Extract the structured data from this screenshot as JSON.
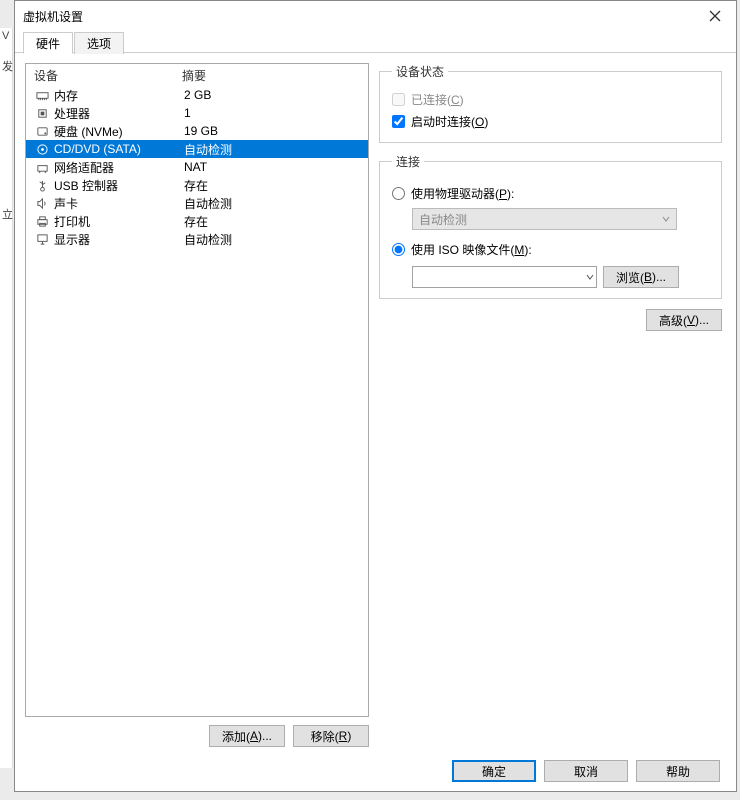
{
  "leftSlice": {
    "a": "V",
    "b": "发",
    "c": "立"
  },
  "dialog": {
    "title": "虚拟机设置",
    "tabs": {
      "hardware": "硬件",
      "options": "选项"
    },
    "headers": {
      "device": "设备",
      "summary": "摘要"
    },
    "devices": [
      {
        "key": "memory",
        "icon": "memory-icon",
        "name": "内存",
        "summary": "2 GB",
        "selected": false
      },
      {
        "key": "cpu",
        "icon": "cpu-icon",
        "name": "处理器",
        "summary": "1",
        "selected": false
      },
      {
        "key": "disk",
        "icon": "disk-icon",
        "name": "硬盘 (NVMe)",
        "summary": "19 GB",
        "selected": false
      },
      {
        "key": "cddvd",
        "icon": "disc-icon",
        "name": "CD/DVD (SATA)",
        "summary": "自动检测",
        "selected": true
      },
      {
        "key": "network",
        "icon": "network-icon",
        "name": "网络适配器",
        "summary": "NAT",
        "selected": false
      },
      {
        "key": "usb",
        "icon": "usb-icon",
        "name": "USB 控制器",
        "summary": "存在",
        "selected": false
      },
      {
        "key": "sound",
        "icon": "sound-icon",
        "name": "声卡",
        "summary": "自动检测",
        "selected": false
      },
      {
        "key": "printer",
        "icon": "printer-icon",
        "name": "打印机",
        "summary": "存在",
        "selected": false
      },
      {
        "key": "display",
        "icon": "display-icon",
        "name": "显示器",
        "summary": "自动检测",
        "selected": false
      }
    ],
    "buttons": {
      "add": {
        "text": "添加(",
        "u": "A",
        "suffix": ")..."
      },
      "remove": {
        "text": "移除(",
        "u": "R",
        "suffix": ")"
      },
      "ok": "确定",
      "cancel": "取消",
      "help": "帮助"
    },
    "deviceStatus": {
      "legend": "设备状态",
      "connected": {
        "label": "已连接(",
        "u": "C",
        "suffix": ")",
        "checked": false,
        "disabled": true
      },
      "connectAtStart": {
        "label": "启动时连接(",
        "u": "O",
        "suffix": ")",
        "checked": true
      }
    },
    "connection": {
      "legend": "连接",
      "physical": {
        "label": "使用物理驱动器(",
        "u": "P",
        "suffix": "):",
        "selected": false
      },
      "autoDetect": "自动检测",
      "iso": {
        "label": "使用 ISO 映像文件(",
        "u": "M",
        "suffix": "):",
        "selected": true
      },
      "isoValue": "",
      "browse": {
        "text": "浏览(",
        "u": "B",
        "suffix": ")..."
      }
    },
    "advanced": {
      "text": "高级(",
      "u": "V",
      "suffix": ")..."
    }
  }
}
